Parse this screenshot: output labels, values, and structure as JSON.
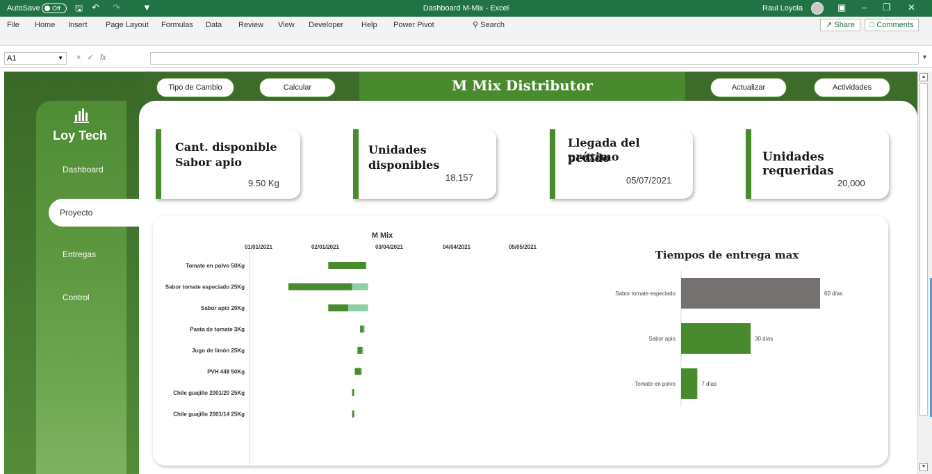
{
  "titlebar": {
    "autosave_label": "AutoSave",
    "autosave_state": "Off",
    "title": "Dashboard M-Mix  -  Excel",
    "user": "Raul Loyola"
  },
  "menu": {
    "items": [
      "File",
      "Home",
      "Insert",
      "Page Layout",
      "Formulas",
      "Data",
      "Review",
      "View",
      "Developer",
      "Help",
      "Power Pivot"
    ],
    "search": "Search",
    "share": "Share",
    "comments": "Comments"
  },
  "formula": {
    "namebox": "A1",
    "fx": "fx",
    "cancel": "×",
    "enter": "✓"
  },
  "sidebar": {
    "logo": "Loy Tech",
    "nav": [
      "Dashboard",
      "Proyecto",
      "Entregas",
      "Control"
    ],
    "active": "Proyecto"
  },
  "buttons": {
    "tipo_cambio": "Tipo de Cambio",
    "calcular": "Calcular",
    "actualizar": "Actualizar",
    "actividades": "Actividades"
  },
  "banner": "M Mix Distributor",
  "kpis": [
    {
      "label1": "Cant. disponible",
      "label2": "Sabor apio",
      "value": "9.50 Kg"
    },
    {
      "label1": "Unidades",
      "label2": "disponibles",
      "value": "18,157"
    },
    {
      "label1": "Llegada del próximo",
      "label2": "pedido",
      "value": "05/07/2021"
    },
    {
      "label1": "Unidades requeridas",
      "label2": "",
      "value": "20,000"
    }
  ],
  "chart_data": [
    {
      "type": "bar",
      "title": "M Mix",
      "orientation": "horizontal-gantt",
      "x_ticks": [
        "01/01/2021",
        "02/01/2021",
        "03/04/2021",
        "04/04/2021",
        "05/05/2021"
      ],
      "categories": [
        "Tomate en polvo 50Kg",
        "Sabor tomate especiado 25Kg",
        "Sabor apio 20Kg",
        "Pasta de tomate 3Kg",
        "Jugo de limón 25Kg",
        "PVH 448 50Kg",
        "Chile guajillo 2001/20 25Kg",
        "Chile guajillo 2001/14 25Kg"
      ],
      "series": [
        {
          "color": "#4a8a2e",
          "start_days": [
            60,
            0,
            60,
            108,
            104,
            100,
            96,
            96
          ],
          "duration_days": [
            57,
            96,
            30,
            5,
            7,
            9,
            3,
            3
          ]
        },
        {
          "color": "#8dcfa6",
          "start_days": [
            117,
            96,
            90,
            113,
            111,
            109,
            99,
            99
          ],
          "duration_days": [
            0,
            24,
            30,
            2,
            2,
            2,
            0,
            0
          ]
        }
      ],
      "colors": {
        "primary": "#4a8a2e",
        "secondary": "#8dcfa6"
      }
    },
    {
      "type": "bar",
      "title": "Tiempos de entrega max",
      "orientation": "horizontal",
      "categories": [
        "Sabor tomate especiado",
        "Sabor apio",
        "Tomate en polvo"
      ],
      "values": [
        60,
        30,
        7
      ],
      "labels": [
        "60 días",
        "30 días",
        "7 días"
      ],
      "bar_colors": [
        "#767171",
        "#4a8a2e",
        "#4a8a2e"
      ],
      "xlim": [
        0,
        65
      ]
    }
  ]
}
